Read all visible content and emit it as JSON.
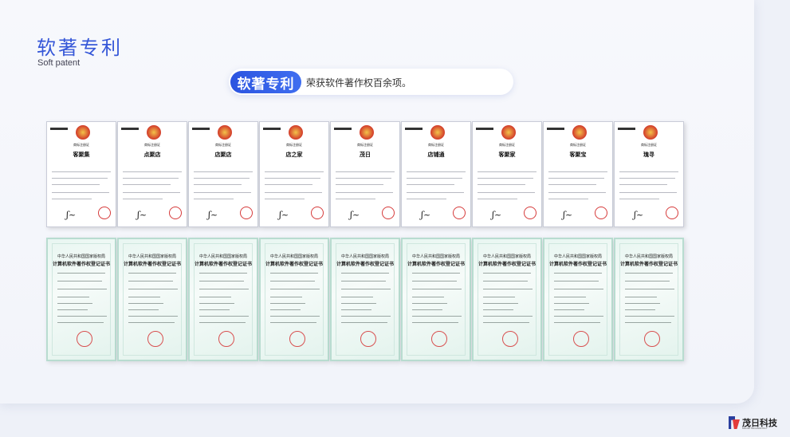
{
  "header": {
    "title": "软著专利",
    "subtitle": "Soft patent"
  },
  "banner": {
    "badge": "软著专利",
    "text": "荣获软件著作权百余项。"
  },
  "trademark_certificates": [
    {
      "heading": "商标注册证",
      "name": "客聚集"
    },
    {
      "heading": "商标注册证",
      "name": "点聚店"
    },
    {
      "heading": "商标注册证",
      "name": "店聚店"
    },
    {
      "heading": "商标注册证",
      "name": "店之家"
    },
    {
      "heading": "商标注册证",
      "name": "茂日"
    },
    {
      "heading": "商标注册证",
      "name": "店铺通"
    },
    {
      "heading": "商标注册证",
      "name": "客聚家"
    },
    {
      "heading": "商标注册证",
      "name": "客聚宝"
    },
    {
      "heading": "商标注册证",
      "name": "瑰寻"
    }
  ],
  "software_certificates": [
    {
      "authority": "中华人民共和国国家版权局",
      "title": "计算机软件著作权登记证书"
    },
    {
      "authority": "中华人民共和国国家版权局",
      "title": "计算机软件著作权登记证书"
    },
    {
      "authority": "中华人民共和国国家版权局",
      "title": "计算机软件著作权登记证书"
    },
    {
      "authority": "中华人民共和国国家版权局",
      "title": "计算机软件著作权登记证书"
    },
    {
      "authority": "中华人民共和国国家版权局",
      "title": "计算机软件著作权登记证书"
    },
    {
      "authority": "中华人民共和国国家版权局",
      "title": "计算机软件著作权登记证书"
    },
    {
      "authority": "中华人民共和国国家版权局",
      "title": "计算机软件著作权登记证书"
    },
    {
      "authority": "中华人民共和国国家版权局",
      "title": "计算机软件著作权登记证书"
    },
    {
      "authority": "中华人民共和国国家版权局",
      "title": "计算机软件著作权登记证书"
    }
  ],
  "logo": {
    "name": "茂日科技",
    "tagline": "MAORI TECHNOLOGY"
  }
}
